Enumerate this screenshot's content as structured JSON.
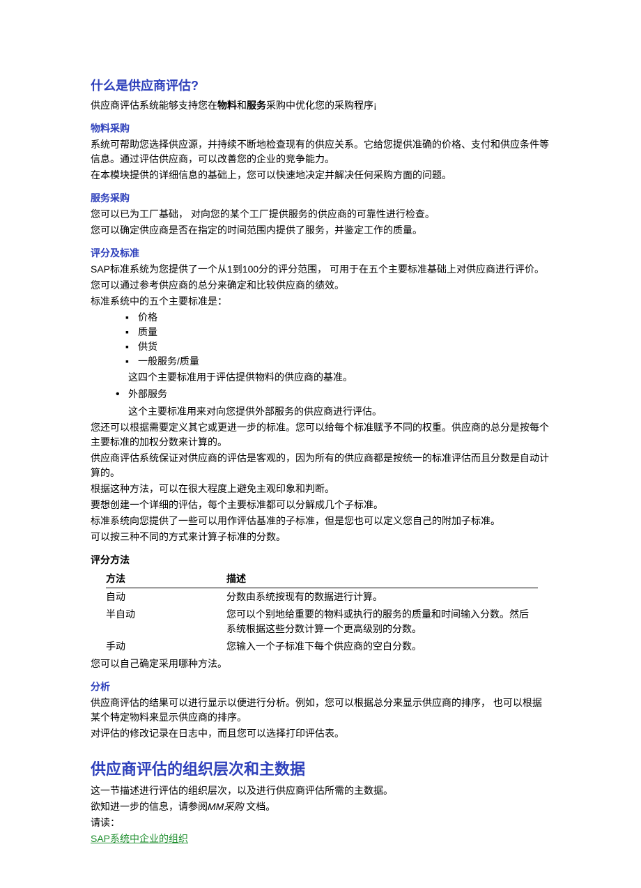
{
  "section1": {
    "title": "什么是供应商评估?",
    "intro_prefix": "供应商评估系统能够支持您在",
    "intro_b1": "物料",
    "intro_mid": "和",
    "intro_b2": "服务",
    "intro_suffix": "采购中优化您的采购程序¡",
    "sub_material": {
      "title": "物料采购",
      "p1": "系统可帮助您选择供应源，并持续不断地检查现有的供应关系。它给您提供准确的价格、支付和供应条件等信息。通过评估供应商，可以改善您的企业的竞争能力。",
      "p2": "在本模块提供的详细信息的基础上，您可以快速地决定并解决任何采购方面的问题。"
    },
    "sub_service": {
      "title": "服务采购",
      "p1": "您可以已为工厂基础，  对向您的某个工厂提供服务的供应商的可靠性进行检查。",
      "p2": "您可以确定供应商是否在指定的时间范围内提供了服务，并鉴定工作的质量。"
    },
    "sub_criteria": {
      "title": "评分及标准",
      "p1": "SAP标准系统为您提供了一个从1到100分的评分范围，  可用于在五个主要标准基础上对供应商进行评价。",
      "p2": "您可以通过参考供应商的总分来确定和比较供应商的绩效。",
      "p3": "标准系统中的五个主要标准是：",
      "items_a": [
        "价格",
        "质量",
        "供货",
        "一般服务/质量"
      ],
      "note_a": "这四个主要标准用于评估提供物料的供应商的基准。",
      "items_b": [
        "外部服务"
      ],
      "note_b": "这个主要标准用来对向您提供外部服务的供应商进行评估。",
      "p4": "您还可以根据需要定义其它或更进一步的标准。您可以给每个标准赋予不同的权重。供应商的总分是按每个主要标准的加权分数来计算的。",
      "p5": "供应商评估系统保证对供应商的评估是客观的，因为所有的供应商都是按统一的标准评估而且分数是自动计算的。",
      "p6": "根据这种方法，可以在很大程度上避免主观印象和判断。",
      "p7": "要想创建一个详细的评估，每个主要标准都可以分解成几个子标准。",
      "p8": "标准系统向您提供了一些可以用作评估基准的子标准，但是您也可以定义您自己的附加子标准。",
      "p9": "可以按三种不同的方式来计算子标准的分数。"
    },
    "sub_method": {
      "title": "评分方法",
      "table": {
        "h1": "方法",
        "h2": "描述",
        "rows": [
          {
            "m": "自动",
            "d": "分数由系统按现有的数据进行计算。"
          },
          {
            "m": "半自动",
            "d": "您可以个别地给重要的物料或执行的服务的质量和时间输入分数。然后系统根据这些分数计算一个更高级别的分数。"
          },
          {
            "m": "手动",
            "d": "您输入一个子标准下每个供应商的空白分数。"
          }
        ]
      },
      "p_after": "您可以自己确定采用哪种方法。"
    },
    "sub_analysis": {
      "title": "分析",
      "p1": "供应商评估的结果可以进行显示以便进行分析。例如，您可以根据总分来显示供应商的排序，  也可以根据某个特定物料来显示供应商的排序。",
      "p2": "对评估的修改记录在日志中，而且您可以选择打印评估表。"
    }
  },
  "section2": {
    "title": "供应商评估的组织层次和主数据",
    "p1": "这一节描述进行评估的组织层次，以及进行供应商评估所需的主数据。",
    "p2_prefix": "欲知进一步的信息，请参阅",
    "p2_italic": "MM采购",
    "p2_suffix": " 文档。",
    "p3": "请读：",
    "link": "SAP系统中企业的组织"
  }
}
